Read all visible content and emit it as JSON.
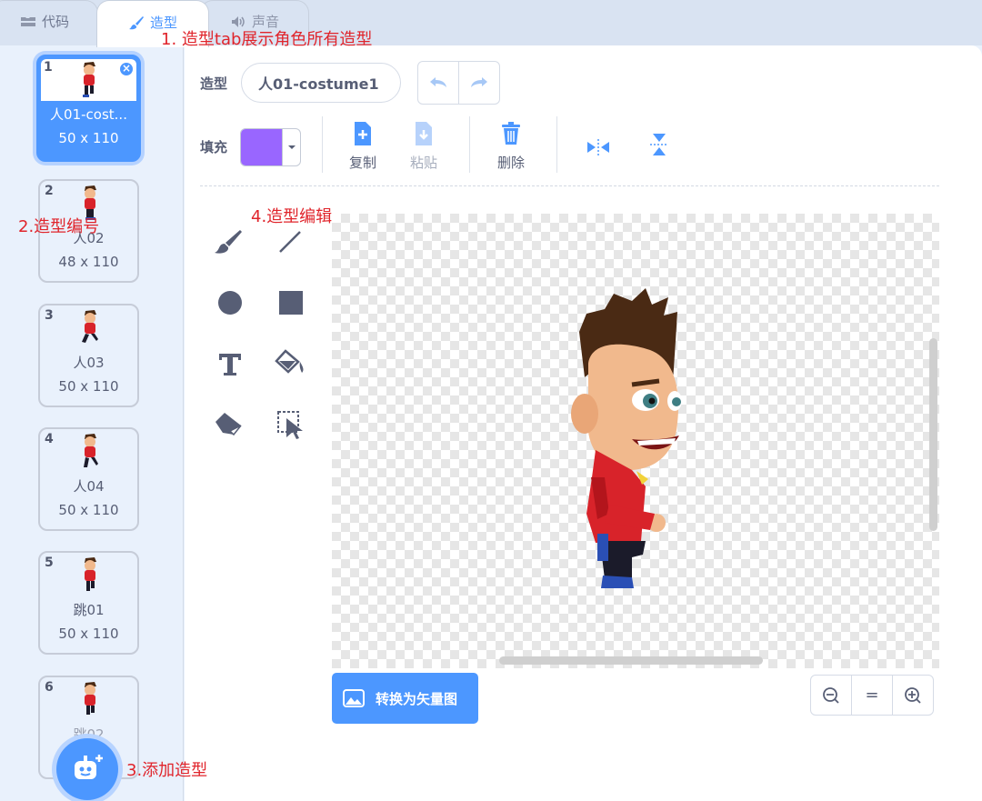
{
  "tabs": {
    "code": "代码",
    "costume": "造型",
    "sound": "声音"
  },
  "annotations": {
    "a1": "1. 造型tab展示角色所有造型",
    "a2": "2.造型编号",
    "a3": "3.添加造型",
    "a4": "4.造型编辑"
  },
  "costumes": [
    {
      "num": "1",
      "name": "人01-cost...",
      "size": "50 x 110",
      "selected": true
    },
    {
      "num": "2",
      "name": "人02",
      "size": "48 x 110"
    },
    {
      "num": "3",
      "name": "人03",
      "size": "50 x 110"
    },
    {
      "num": "4",
      "name": "人04",
      "size": "50 x 110"
    },
    {
      "num": "5",
      "name": "跳01",
      "size": "50 x 110"
    },
    {
      "num": "6",
      "name": "跳02",
      "size": ""
    }
  ],
  "editor": {
    "costume_label": "造型",
    "costume_name": "人01-costume1",
    "fill_label": "填充",
    "fill_color": "#9966ff",
    "copy": "复制",
    "paste": "粘贴",
    "delete": "删除",
    "convert": "转换为矢量图",
    "zoom_reset": "="
  },
  "colors": {
    "accent": "#4c97ff",
    "annotation": "#e0242b"
  }
}
